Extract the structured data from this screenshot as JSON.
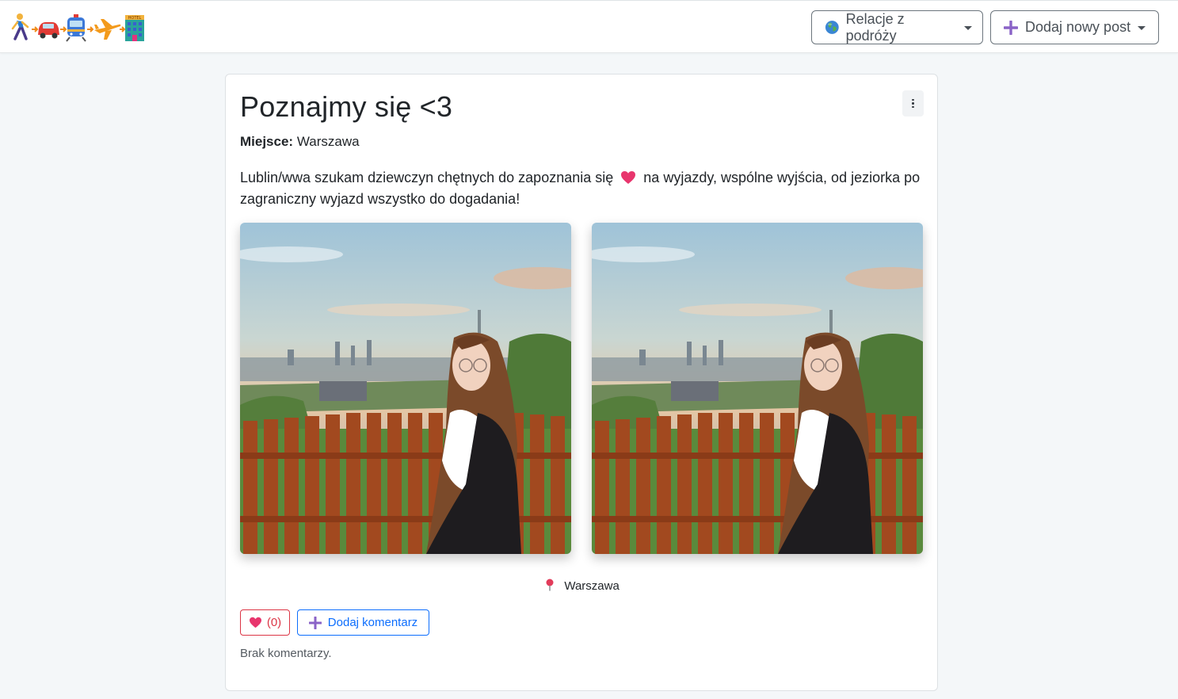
{
  "navbar": {
    "brand_icons": [
      "person-walking-icon",
      "car-icon",
      "train-icon",
      "airplane-icon",
      "hotel-icon"
    ],
    "relacje_label": "Relacje z podróży",
    "dodaj_label": "Dodaj nowy post"
  },
  "post": {
    "title": "Poznajmy się <3",
    "place_label": "Miejsce:",
    "place_value": "Warszawa",
    "description_part1": "Lublin/wwa szukam dziewczyn chętnych do zapoznania się",
    "description_part2": "na wyjazdy, wspólne wyjścia, od jeziorka po zagraniczny wyjazd wszystko do dogadania!",
    "photos": [
      "photo-1",
      "photo-2"
    ],
    "location_text": "Warszawa",
    "likes_text": "(0)",
    "comment_button_label": "Dodaj komentarz",
    "no_comments_text": "Brak komentarzy."
  },
  "colors": {
    "like": "#dc3545",
    "comment": "#0d6efd",
    "heart": "#e8356d",
    "plus": "#8a63c7"
  }
}
